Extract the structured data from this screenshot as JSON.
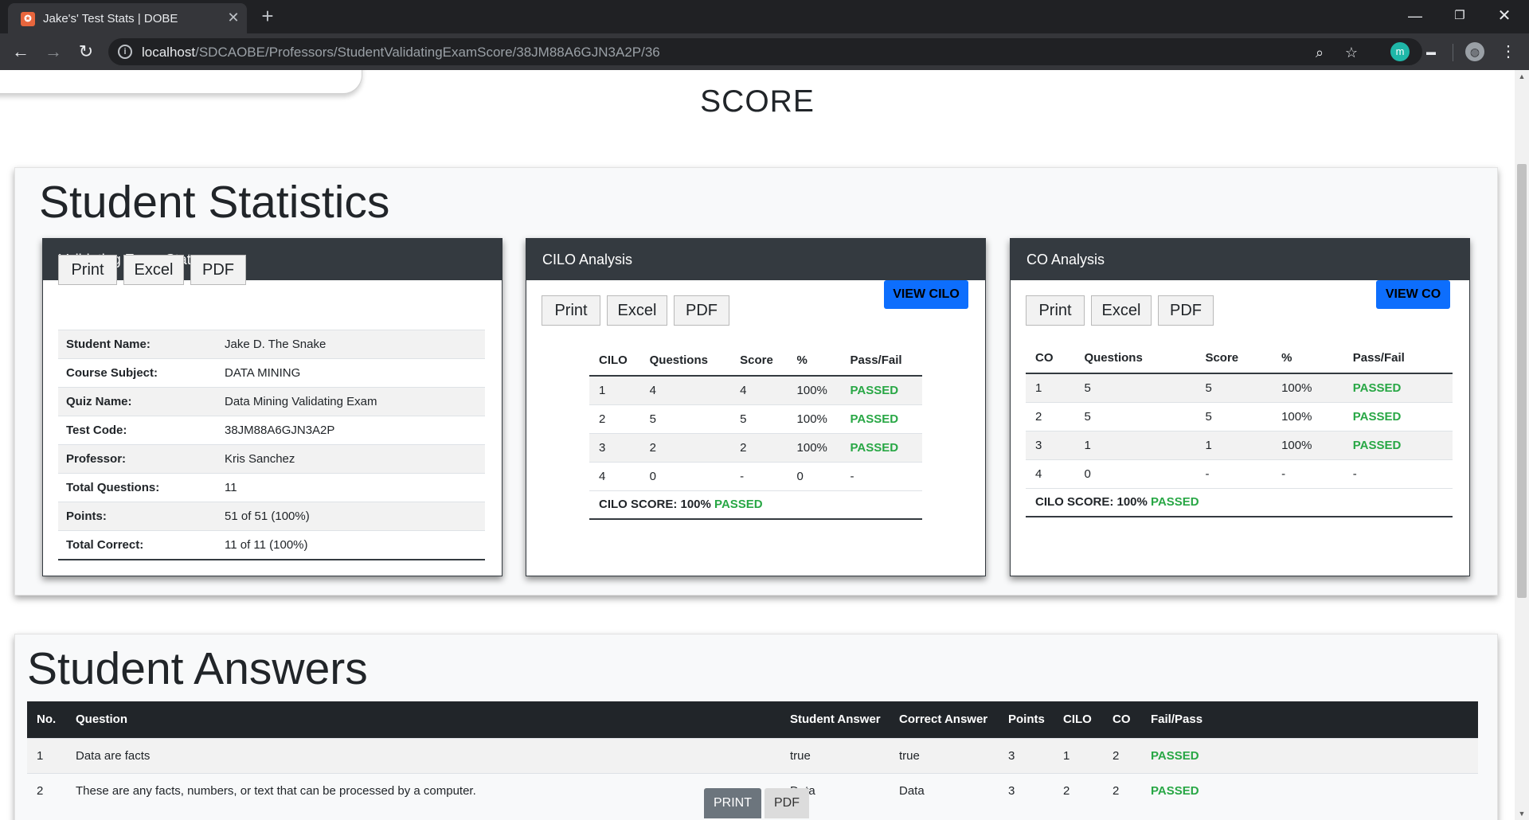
{
  "browser": {
    "tab_title": "Jake's' Test Stats | DOBE",
    "url_host": "localhost",
    "url_path": "/SDCAOBE/Professors/StudentValidatingExamScore/38JM88A6GJN3A2P/36"
  },
  "icons": {
    "favicon": "xampp-icon",
    "close": "✕",
    "plus": "+",
    "back": "←",
    "forward": "→",
    "reload": "↻",
    "info": "i",
    "zoom": "⌕",
    "star": "☆",
    "ext_m": "m",
    "ext_pix": "▬",
    "avatar": "◍",
    "menu": "⋮",
    "minimize": "—",
    "maximize": "❐",
    "close_window": "✕",
    "scroll_up": "▲",
    "scroll_down": "▼"
  },
  "page": {
    "score_heading": "SCORE"
  },
  "stats": {
    "title": "Student Statistics",
    "validating": {
      "heading": "Validating Exam Stats",
      "buttons": [
        "Print",
        "Excel",
        "PDF"
      ],
      "rows": [
        {
          "label": "Student Name:",
          "value": "Jake D. The Snake"
        },
        {
          "label": "Course Subject:",
          "value": "DATA MINING"
        },
        {
          "label": "Quiz Name:",
          "value": "Data Mining Validating Exam"
        },
        {
          "label": "Test Code:",
          "value": "38JM88A6GJN3A2P"
        },
        {
          "label": "Professor:",
          "value": "Kris Sanchez"
        },
        {
          "label": "Total Questions:",
          "value": "11"
        },
        {
          "label": "Points:",
          "value": "51 of 51 (100%)"
        },
        {
          "label": "Total Correct:",
          "value": "11 of 11 (100%)"
        }
      ]
    },
    "cilo": {
      "heading": "CILO Analysis",
      "view_button": "VIEW CILO",
      "buttons": [
        "Print",
        "Excel",
        "PDF"
      ],
      "columns": [
        "CILO",
        "Questions",
        "Score",
        "%",
        "Pass/Fail"
      ],
      "rows": [
        [
          "1",
          "4",
          "4",
          "100%",
          "PASSED"
        ],
        [
          "2",
          "5",
          "5",
          "100%",
          "PASSED"
        ],
        [
          "3",
          "2",
          "2",
          "100%",
          "PASSED"
        ],
        [
          "4",
          "0",
          "-",
          "0",
          "-"
        ]
      ],
      "score_label": "CILO SCORE: 100%",
      "score_status": "PASSED"
    },
    "co": {
      "heading": "CO Analysis",
      "view_button": "VIEW CO",
      "buttons": [
        "Print",
        "Excel",
        "PDF"
      ],
      "columns": [
        "CO",
        "Questions",
        "Score",
        "%",
        "Pass/Fail"
      ],
      "rows": [
        [
          "1",
          "5",
          "5",
          "100%",
          "PASSED"
        ],
        [
          "2",
          "5",
          "5",
          "100%",
          "PASSED"
        ],
        [
          "3",
          "1",
          "1",
          "100%",
          "PASSED"
        ],
        [
          "4",
          "0",
          "-",
          "-",
          "-"
        ]
      ],
      "score_label": "CILO SCORE: 100%",
      "score_status": "PASSED"
    }
  },
  "answers": {
    "title": "Student Answers",
    "columns": [
      "No.",
      "Question",
      "Student Answer",
      "Correct Answer",
      "Points",
      "CILO",
      "CO",
      "Fail/Pass"
    ],
    "rows": [
      [
        "1",
        "Data are facts",
        "true",
        "true",
        "3",
        "1",
        "2",
        "PASSED"
      ],
      [
        "2",
        "These are any facts, numbers, or text that can be processed by a computer.",
        "Data",
        "Data",
        "3",
        "2",
        "2",
        "PASSED"
      ]
    ]
  },
  "floating_buttons": {
    "print": "PRINT",
    "pdf": "PDF"
  },
  "colors": {
    "passed": "#28a745",
    "view_button": "#0d6efd",
    "panel_header": "#343a40"
  }
}
